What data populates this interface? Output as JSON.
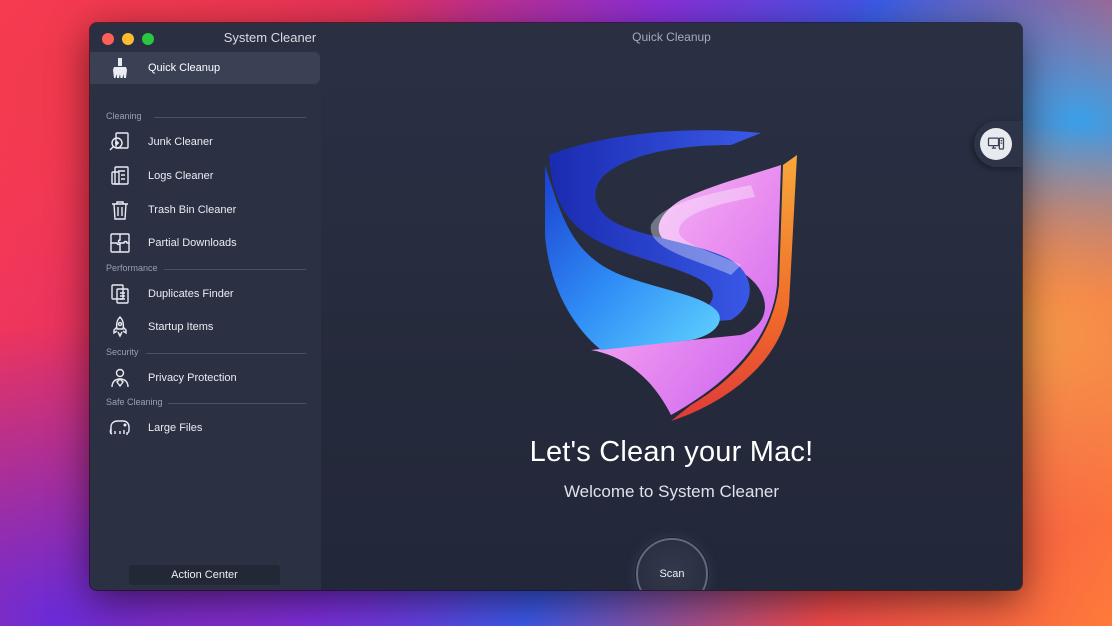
{
  "window": {
    "app_title": "System Cleaner",
    "title": "Quick Cleanup"
  },
  "sidebar": {
    "quick_cleanup": {
      "label": "Quick Cleanup",
      "icon": "broom-icon"
    },
    "sections": [
      {
        "label": "Cleaning",
        "items": [
          {
            "label": "Junk Cleaner",
            "icon": "magnifier-document-icon"
          },
          {
            "label": "Logs Cleaner",
            "icon": "logs-icon"
          },
          {
            "label": "Trash Bin Cleaner",
            "icon": "trash-icon"
          },
          {
            "label": "Partial Downloads",
            "icon": "puzzle-icon"
          }
        ]
      },
      {
        "label": "Performance",
        "items": [
          {
            "label": "Duplicates Finder",
            "icon": "duplicate-files-icon"
          },
          {
            "label": "Startup Items",
            "icon": "rocket-icon"
          }
        ]
      },
      {
        "label": "Security",
        "items": [
          {
            "label": "Privacy Protection",
            "icon": "user-shield-icon"
          }
        ]
      },
      {
        "label": "Safe Cleaning",
        "items": [
          {
            "label": "Large Files",
            "icon": "elephant-icon"
          }
        ]
      }
    ],
    "action_center": "Action Center"
  },
  "main": {
    "headline": "Let's Clean your Mac!",
    "subheadline": "Welcome to System Cleaner",
    "scan_button": "Scan",
    "side_tab_icon": "computer-icon"
  },
  "colors": {
    "window_bg": "#232838",
    "sidebar_bg": "#2b3143",
    "active_item_bg": "#3a4155",
    "accent_blue": "#2a8cf5",
    "accent_pink": "#e98ff0",
    "accent_orange": "#f59b2a"
  }
}
